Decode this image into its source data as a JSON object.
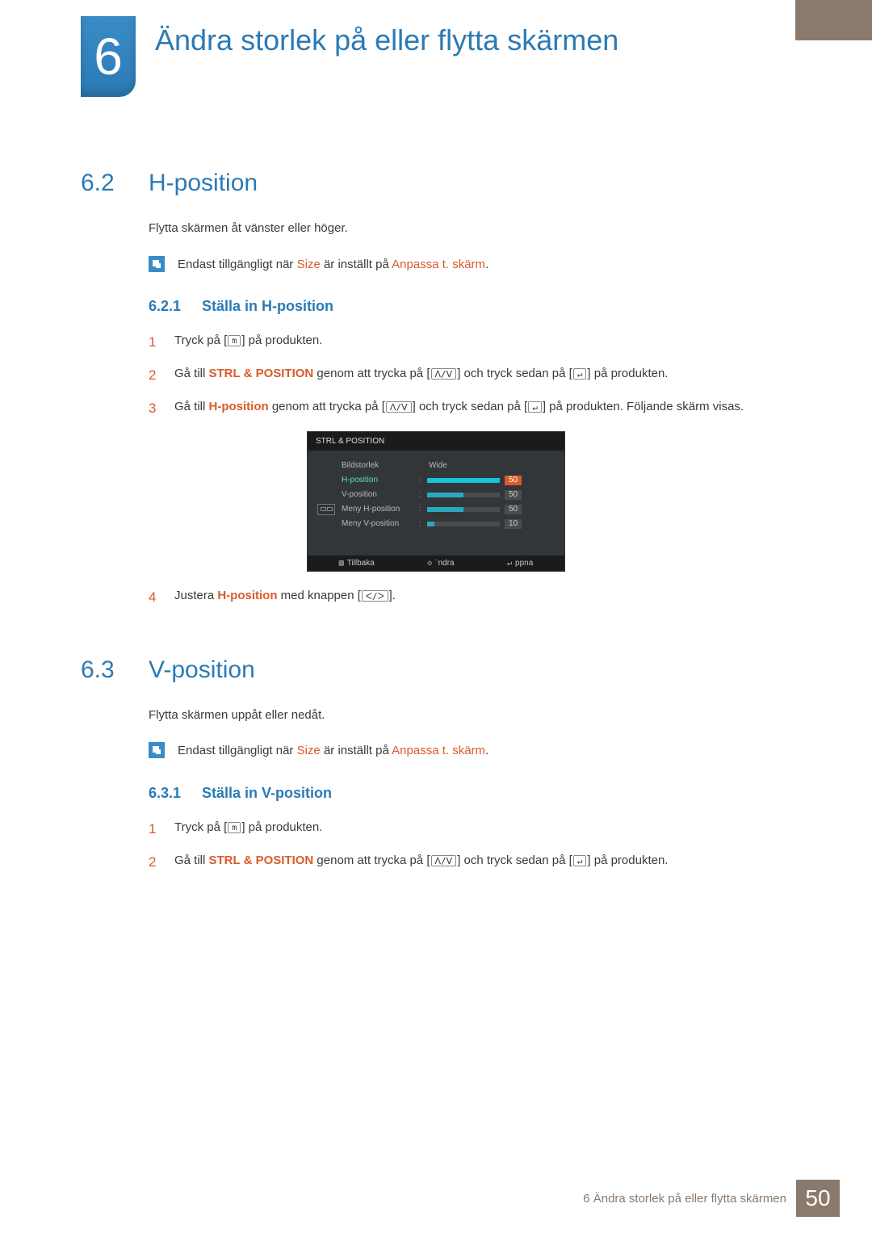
{
  "chapter": {
    "number": "6",
    "title": "Ändra storlek på eller flytta skärmen"
  },
  "sections": [
    {
      "num": "6.2",
      "title": "H-position",
      "intro": "Flytta skärmen åt vänster eller höger.",
      "note_pre": "Endast tillgängligt när ",
      "note_size": "Size",
      "note_mid": " är inställt på ",
      "note_mode": "Anpassa t. skärm",
      "note_post": ".",
      "sub": {
        "num": "6.2.1",
        "title": "Ställa in H-position"
      },
      "steps": {
        "s1_pre": "Tryck på [",
        "s1_btn": "m",
        "s1_post": "] på produkten.",
        "s2_a": "Gå till ",
        "s2_b": "STRL & POSITION",
        "s2_c": " genom att trycka på [",
        "s2_d": "] och tryck sedan på [",
        "s2_e": "] på produkten.",
        "s3_a": "Gå till ",
        "s3_b": "H-position",
        "s3_c": " genom att trycka på [",
        "s3_d": "] och tryck sedan på [",
        "s3_e": "] på produkten. Följande skärm visas.",
        "s4_a": "Justera ",
        "s4_b": "H-position",
        "s4_c": " med knappen [",
        "s4_d": "]."
      }
    },
    {
      "num": "6.3",
      "title": "V-position",
      "intro": "Flytta skärmen uppåt eller nedåt.",
      "note_pre": "Endast tillgängligt när ",
      "note_size": "Size",
      "note_mid": " är inställt på ",
      "note_mode": "Anpassa t. skärm",
      "note_post": ".",
      "sub": {
        "num": "6.3.1",
        "title": "Ställa in V-position"
      },
      "steps": {
        "s1_pre": "Tryck på [",
        "s1_btn": "m",
        "s1_post": "] på produkten.",
        "s2_a": "Gå till ",
        "s2_b": "STRL & POSITION",
        "s2_c": " genom att trycka på [",
        "s2_d": "] och tryck sedan på [",
        "s2_e": "] på produkten."
      }
    }
  ],
  "osd": {
    "title": "STRL & POSITION",
    "rows": [
      {
        "label": "Bildstorlek",
        "value_text": "Wide"
      },
      {
        "label": "H-position",
        "active": true,
        "value": 50,
        "max": 50
      },
      {
        "label": "V-position",
        "value": 50,
        "max": 100
      },
      {
        "label": "Meny H-position",
        "value": 50,
        "max": 100
      },
      {
        "label": "Meny V-position",
        "value": 10,
        "max": 100
      }
    ],
    "footer": {
      "back": "Tillbaka",
      "adjust": "¨ndra",
      "open": "ppna"
    }
  },
  "icons": {
    "updown": "ᐱ/ᐯ",
    "enter": "↵",
    "leftright": "ᐸ/ᐳ",
    "menu": "m"
  },
  "footer": {
    "text": "6 Ändra storlek på eller flytta skärmen",
    "page": "50"
  }
}
